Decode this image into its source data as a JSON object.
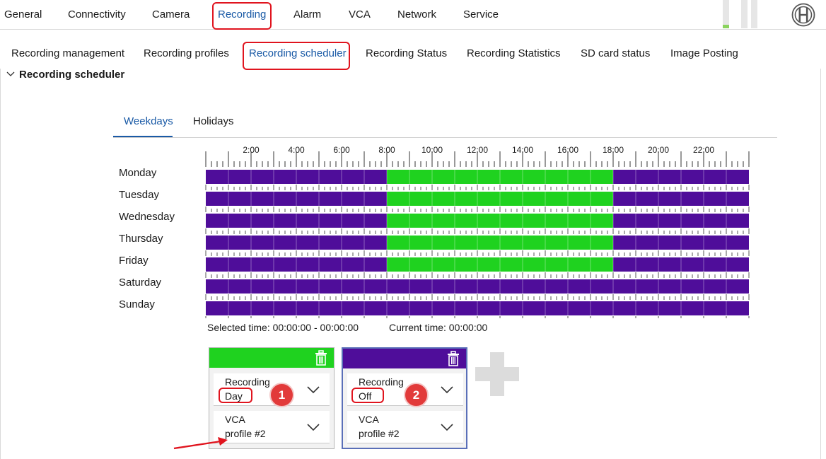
{
  "top_nav": {
    "tabs": [
      "General",
      "Connectivity",
      "Camera",
      "Recording",
      "Alarm",
      "VCA",
      "Network",
      "Service"
    ],
    "active": "Recording"
  },
  "sub_nav": {
    "tabs": [
      "Recording management",
      "Recording profiles",
      "Recording scheduler",
      "Recording Status",
      "Recording Statistics",
      "SD card status",
      "Image Posting"
    ],
    "active": "Recording scheduler"
  },
  "section": {
    "title": "Recording scheduler"
  },
  "schedule_tabs": {
    "weekdays": "Weekdays",
    "holidays": "Holidays",
    "active": "Weekdays"
  },
  "time_axis": {
    "labels": [
      "2:00",
      "4:00",
      "6:00",
      "8:00",
      "10:00",
      "12:00",
      "14:00",
      "16:00",
      "18:00",
      "20:00",
      "22:00"
    ]
  },
  "days": [
    "Monday",
    "Tuesday",
    "Wednesday",
    "Thursday",
    "Friday",
    "Saturday",
    "Sunday"
  ],
  "schedule": {
    "colors": {
      "day": "#1fd21f",
      "off": "#4f0d9a"
    },
    "rows": [
      [
        {
          "from": 0,
          "to": 8,
          "profile": "off"
        },
        {
          "from": 8,
          "to": 18,
          "profile": "day"
        },
        {
          "from": 18,
          "to": 24,
          "profile": "off"
        }
      ],
      [
        {
          "from": 0,
          "to": 8,
          "profile": "off"
        },
        {
          "from": 8,
          "to": 18,
          "profile": "day"
        },
        {
          "from": 18,
          "to": 24,
          "profile": "off"
        }
      ],
      [
        {
          "from": 0,
          "to": 8,
          "profile": "off"
        },
        {
          "from": 8,
          "to": 18,
          "profile": "day"
        },
        {
          "from": 18,
          "to": 24,
          "profile": "off"
        }
      ],
      [
        {
          "from": 0,
          "to": 8,
          "profile": "off"
        },
        {
          "from": 8,
          "to": 18,
          "profile": "day"
        },
        {
          "from": 18,
          "to": 24,
          "profile": "off"
        }
      ],
      [
        {
          "from": 0,
          "to": 8,
          "profile": "off"
        },
        {
          "from": 8,
          "to": 18,
          "profile": "day"
        },
        {
          "from": 18,
          "to": 24,
          "profile": "off"
        }
      ],
      [
        {
          "from": 0,
          "to": 24,
          "profile": "off"
        }
      ],
      [
        {
          "from": 0,
          "to": 24,
          "profile": "off"
        }
      ]
    ]
  },
  "selected_time": "Selected time: 00:00:00 - 00:00:00",
  "current_time": "Current time: 00:00:00",
  "cards": [
    {
      "color": "#1fd21f",
      "recording_label": "Recording",
      "recording_value": "Day",
      "vca_label": "VCA",
      "vca_value": "profile #2",
      "badge": "1",
      "trash_icon": "trash-icon"
    },
    {
      "color": "#4f0d9a",
      "recording_label": "Recording",
      "recording_value": "Off",
      "vca_label": "VCA",
      "vca_value": "profile #2",
      "badge": "2",
      "trash_icon": "trash-icon"
    }
  ],
  "icons": {
    "add": "plus-icon",
    "dropdown": "chevron-down-icon",
    "logo": "bosch-logo",
    "collapse": "chevron-down-icon"
  },
  "accent": "#1a5aa6",
  "annotation_color": "#e0141e"
}
